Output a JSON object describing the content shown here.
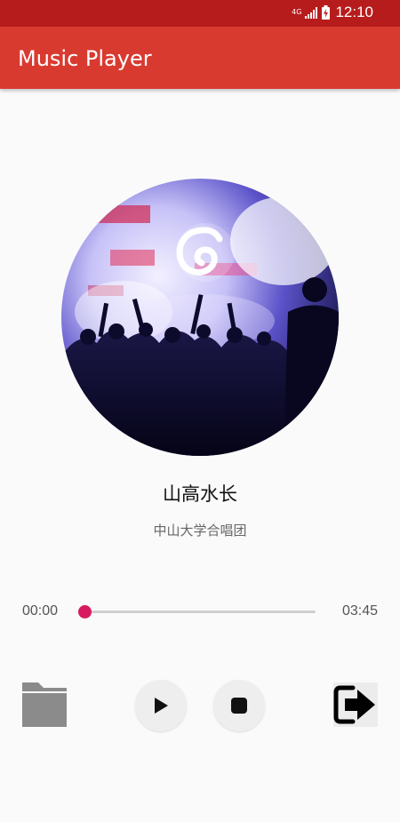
{
  "status_bar": {
    "network": "4G",
    "time": "12:10"
  },
  "app_bar": {
    "title": "Music Player"
  },
  "song": {
    "title": "山高水长",
    "artist": "中山大学合唱团"
  },
  "player": {
    "current_time": "00:00",
    "total_time": "03:45",
    "progress": 0
  },
  "controls": {
    "open_icon": "folder-icon",
    "play_icon": "play-icon",
    "stop_icon": "stop-icon",
    "exit_icon": "exit-icon"
  },
  "colors": {
    "status_bar": "#b71c1c",
    "app_bar": "#d93a30",
    "accent": "#d81b60"
  }
}
